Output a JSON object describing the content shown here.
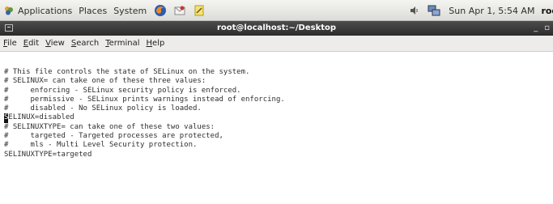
{
  "top_panel": {
    "menus": [
      "Applications",
      "Places",
      "System"
    ],
    "clock": "Sun Apr  1,  5:54 AM",
    "user": "roo"
  },
  "window": {
    "title": "root@localhost:~/Desktop",
    "controls": [
      "_",
      "▫"
    ]
  },
  "menubar": {
    "items": [
      {
        "mnemonic": "F",
        "rest": "ile"
      },
      {
        "mnemonic": "E",
        "rest": "dit"
      },
      {
        "mnemonic": "V",
        "rest": "iew"
      },
      {
        "mnemonic": "S",
        "rest": "earch"
      },
      {
        "mnemonic": "T",
        "rest": "erminal"
      },
      {
        "mnemonic": "H",
        "rest": "elp"
      }
    ]
  },
  "terminal": {
    "lines": [
      "# This file controls the state of SELinux on the system.",
      "# SELINUX= can take one of these three values:",
      "#     enforcing - SELinux security policy is enforced.",
      "#     permissive - SELinux prints warnings instead of enforcing.",
      "#     disabled - No SELinux policy is loaded."
    ],
    "cursor_char": "S",
    "cursor_line_rest": "ELINUX=disabled",
    "lines_after": [
      "# SELINUXTYPE= can take one of these two values:",
      "#     targeted - Targeted processes are protected,",
      "#     mls - Multi Level Security protection.",
      "SELINUXTYPE=targeted"
    ]
  }
}
